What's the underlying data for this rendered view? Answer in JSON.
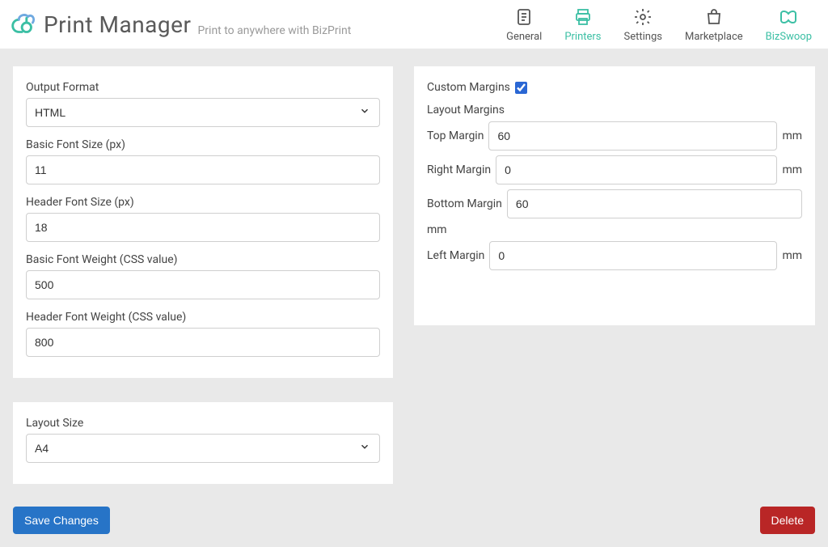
{
  "header": {
    "app_title": "Print Manager",
    "tagline": "Print to anywhere with BizPrint",
    "nav": {
      "general": "General",
      "printers": "Printers",
      "settings": "Settings",
      "marketplace": "Marketplace",
      "bizswoop": "BizSwoop"
    }
  },
  "left_card": {
    "output_format_label": "Output Format",
    "output_format_value": "HTML",
    "basic_font_size_label": "Basic Font Size (px)",
    "basic_font_size_value": "11",
    "header_font_size_label": "Header Font Size (px)",
    "header_font_size_value": "18",
    "basic_font_weight_label": "Basic Font Weight (CSS value)",
    "basic_font_weight_value": "500",
    "header_font_weight_label": "Header Font Weight (CSS value)",
    "header_font_weight_value": "800"
  },
  "layout_card": {
    "layout_size_label": "Layout Size",
    "layout_size_value": "A4"
  },
  "right_card": {
    "custom_margins_label": "Custom Margins",
    "custom_margins_checked": true,
    "layout_margins_title": "Layout Margins",
    "top_margin_label": "Top Margin",
    "top_margin_value": "60",
    "right_margin_label": "Right Margin",
    "right_margin_value": "0",
    "bottom_margin_label": "Bottom Margin",
    "bottom_margin_value": "60",
    "left_margin_label": "Left Margin",
    "left_margin_value": "0",
    "unit": "mm"
  },
  "footer": {
    "save_label": "Save Changes",
    "delete_label": "Delete"
  }
}
